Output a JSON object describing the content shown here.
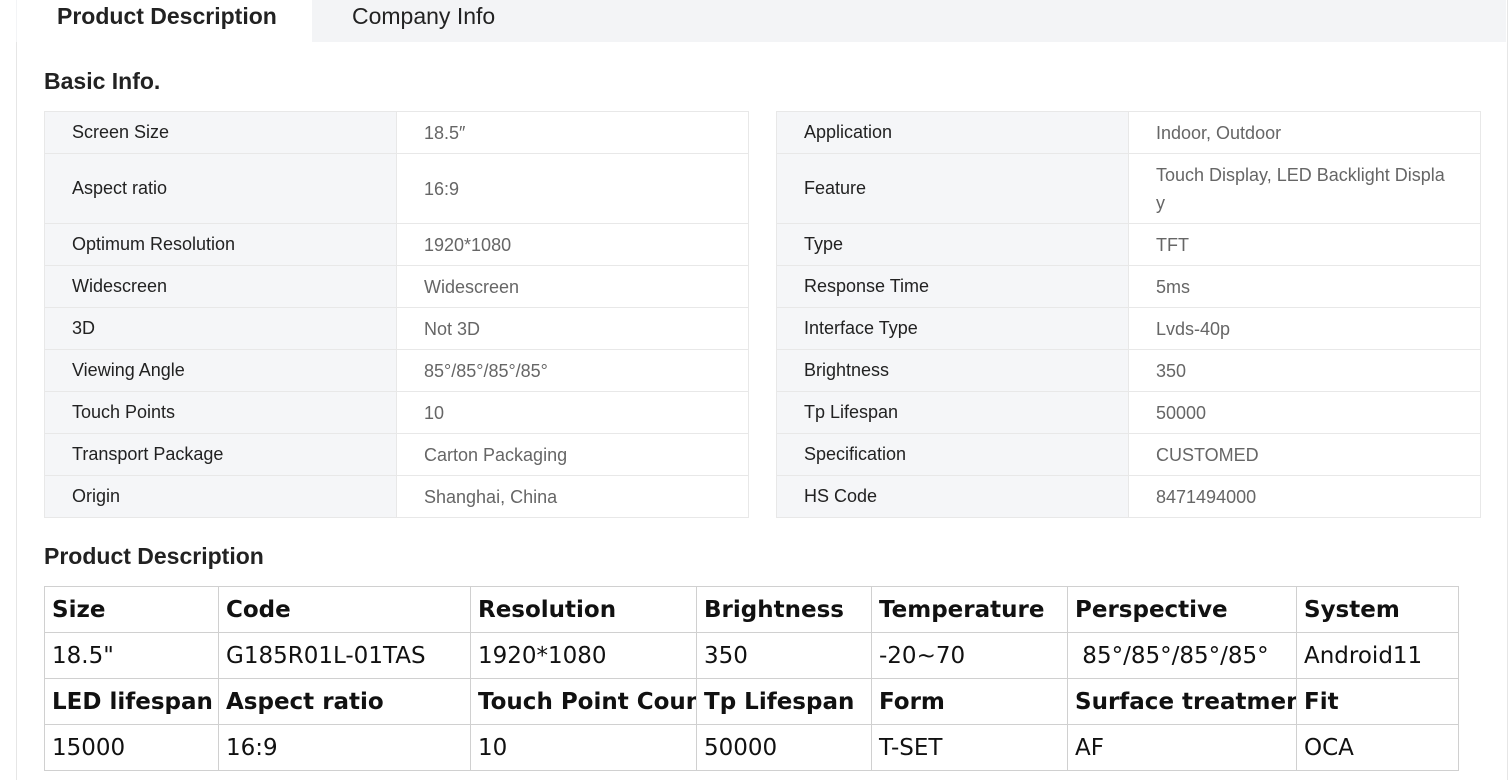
{
  "tabs": [
    {
      "label": "Product Description",
      "active": true
    },
    {
      "label": "Company Info",
      "active": false
    }
  ],
  "basic_info": {
    "title": "Basic Info.",
    "left": [
      {
        "key": "Screen Size",
        "value": "18.5″"
      },
      {
        "key": "Aspect ratio",
        "value": "16:9"
      },
      {
        "key": "Optimum Resolution",
        "value": "1920*1080"
      },
      {
        "key": "Widescreen",
        "value": "Widescreen"
      },
      {
        "key": "3D",
        "value": "Not 3D"
      },
      {
        "key": "Viewing Angle",
        "value": "85°/85°/85°/85°"
      },
      {
        "key": "Touch Points",
        "value": "10"
      },
      {
        "key": "Transport Package",
        "value": "Carton Packaging"
      },
      {
        "key": "Origin",
        "value": "Shanghai, China"
      }
    ],
    "right": [
      {
        "key": "Application",
        "value": "Indoor, Outdoor"
      },
      {
        "key": "Feature",
        "value": "Touch Display, LED Backlight Display"
      },
      {
        "key": "Type",
        "value": "TFT"
      },
      {
        "key": "Response Time",
        "value": "5ms"
      },
      {
        "key": "Interface Type",
        "value": "Lvds-40p"
      },
      {
        "key": "Brightness",
        "value": "350"
      },
      {
        "key": "Tp Lifespan",
        "value": "50000"
      },
      {
        "key": "Specification",
        "value": "CUSTOMED"
      },
      {
        "key": "HS Code",
        "value": "8471494000"
      }
    ]
  },
  "product_description": {
    "title": "Product Description",
    "rows": [
      [
        "Size",
        "Code",
        "Resolution",
        "Brightness",
        "Temperature",
        "Perspective",
        "System"
      ],
      [
        "18.5\"",
        "G185R01L-01TAS",
        "1920*1080",
        "350",
        "-20~70",
        " 85°/85°/85°/85°",
        "Android11"
      ],
      [
        "LED lifespan",
        "Aspect ratio",
        "Touch Point Count",
        "Tp Lifespan",
        "Form",
        "Surface treatment",
        "Fit"
      ],
      [
        "15000",
        "16:9",
        "10",
        "50000",
        "T-SET",
        "AF",
        "OCA"
      ]
    ]
  },
  "colors": {
    "tabbar_bg": "#f3f4f6",
    "key_cell_bg": "#f5f6f8",
    "value_text": "#666666",
    "border": "#e8e8e8"
  }
}
